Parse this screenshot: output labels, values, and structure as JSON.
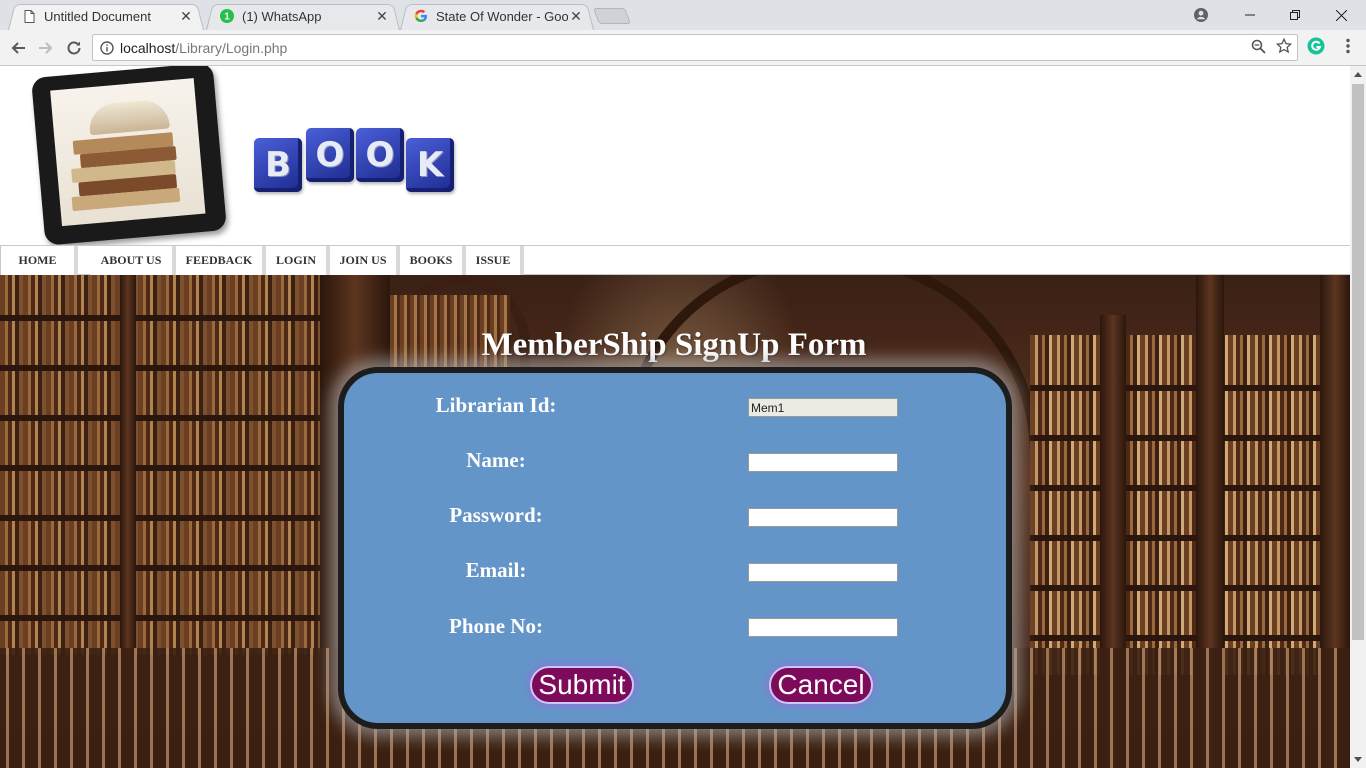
{
  "browser": {
    "tabs": [
      {
        "title": "Untitled Document",
        "favicon": "document-icon",
        "active": true
      },
      {
        "title": "(1) WhatsApp",
        "favicon": "whatsapp-icon",
        "badge": "1"
      },
      {
        "title": "State Of Wonder - Googl",
        "favicon": "google-icon"
      }
    ],
    "address": {
      "host": "localhost",
      "path": "/Library/Login.php"
    }
  },
  "site": {
    "logo_letters": [
      "B",
      "O",
      "O",
      "K"
    ],
    "nav": [
      "HOME",
      "ABOUT US",
      "FEEDBACK",
      "LOGIN",
      "JOIN US",
      "BOOKS",
      "ISSUE"
    ]
  },
  "form": {
    "title": "MemberShip SignUp Form",
    "fields": [
      {
        "label": "Librarian Id:",
        "value": "Mem1",
        "readonly": true
      },
      {
        "label": "Name:",
        "value": ""
      },
      {
        "label": "Password:",
        "value": ""
      },
      {
        "label": "Email:",
        "value": ""
      },
      {
        "label": "Phone No:",
        "value": ""
      }
    ],
    "submit_label": "Submit",
    "cancel_label": "Cancel"
  },
  "colors": {
    "form_bg": "#6495c9",
    "button_bg": "#7d0a5a",
    "grammarly": "#15c39a"
  }
}
